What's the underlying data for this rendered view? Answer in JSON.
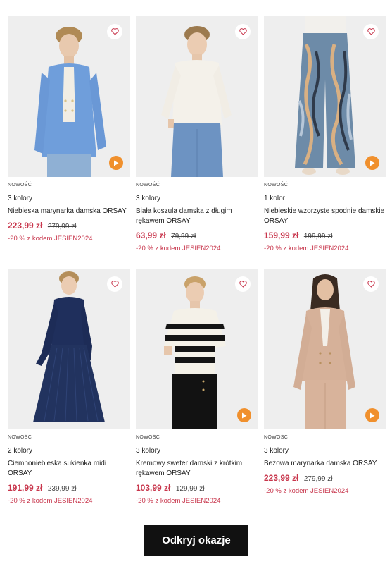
{
  "products": [
    {
      "badge": "NOWOŚĆ",
      "colors": "3 kolory",
      "name": "Niebieska marynarka damska ORSAY",
      "price_new": "223,99 zł",
      "price_old": "279,99 zł",
      "promo": "-20 % z kodem JESIEN2024",
      "has_video": true,
      "image": "blue-blazer-model"
    },
    {
      "badge": "NOWOŚĆ",
      "colors": "3 kolory",
      "name": "Biała koszula damska z długim rękawem ORSAY",
      "price_new": "63,99 zł",
      "price_old": "79,99 zł",
      "promo": "-20 % z kodem JESIEN2024",
      "has_video": false,
      "image": "white-sweater-model"
    },
    {
      "badge": "NOWOŚĆ",
      "colors": "1 kolor",
      "name": "Niebieskie wzorzyste spodnie damskie ORSAY",
      "price_new": "159,99 zł",
      "price_old": "199,99 zł",
      "promo": "-20 % z kodem JESIEN2024",
      "has_video": true,
      "image": "patterned-trousers-model"
    },
    {
      "badge": "NOWOŚĆ",
      "colors": "2 kolory",
      "name": "Ciemnoniebieska sukienka midi ORSAY",
      "price_new": "191,99 zł",
      "price_old": "239,99 zł",
      "promo": "-20 % z kodem JESIEN2024",
      "has_video": false,
      "image": "navy-midi-dress-model"
    },
    {
      "badge": "NOWOŚĆ",
      "colors": "3 kolory",
      "name": "Kremowy sweter damski z krótkim rękawem ORSAY",
      "price_new": "103,99 zł",
      "price_old": "129,99 zł",
      "promo": "-20 % z kodem JESIEN2024",
      "has_video": true,
      "image": "striped-sweater-model"
    },
    {
      "badge": "NOWOŚĆ",
      "colors": "3 kolory",
      "name": "Beżowa marynarka damska ORSAY",
      "price_new": "223,99 zł",
      "price_old": "279,99 zł",
      "promo": "-20 % z kodem JESIEN2024",
      "has_video": true,
      "image": "beige-blazer-model"
    }
  ],
  "cta": {
    "label": "Odkryj okazje"
  },
  "icons": {
    "favorite": "heart-icon",
    "video": "play-icon"
  },
  "theme": {
    "sale_color": "#c8364c",
    "video_badge_color": "#f0902d",
    "cta_background": "#111111",
    "photo_background": "#eeeeee"
  }
}
